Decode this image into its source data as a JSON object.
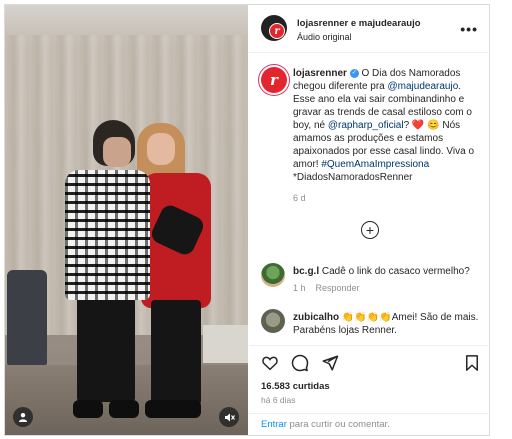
{
  "post": {
    "header": {
      "names": "lojasrenner e majudearaujo",
      "audio": "Áudio original",
      "more": "•••",
      "logo_letter": "r"
    },
    "caption": {
      "user": "lojasrenner",
      "part1": " O Dia dos Namorados chegou diferente pra ",
      "mention1": "@majudearaujo",
      "part2": ". Esse ano ela vai sair combinandinho e gravar as trends de casal estiloso com o boy, né ",
      "mention2": "@rapharp_oficial",
      "part3": "? ❤️ 😊 Nós amamos as produções e estamos apaixonados por esse casal lindo. Viva o amor! ",
      "hashtag": "#QuemAmaImpressiona",
      "part4": " *DiadosNamoradosRenner",
      "time": "6 d"
    },
    "load_more": "+",
    "comments": [
      {
        "user": "bc.g.l",
        "text": " Cadê o link do casaco vermelho?",
        "time": "1 h",
        "reply": "Responder"
      },
      {
        "user": "zubicalho",
        "text": " 👏👏👏👏Amei! São de mais. Parabéns lojas Renner."
      }
    ],
    "likes": "16.583 curtidas",
    "ago": "há 6 dias",
    "footer": {
      "enter": "Entrar",
      "rest": " para curtir ou comentar."
    }
  },
  "colors": {
    "brand_red": "#e3262d",
    "link_blue": "#00376b",
    "verified_blue": "#3897f0"
  }
}
